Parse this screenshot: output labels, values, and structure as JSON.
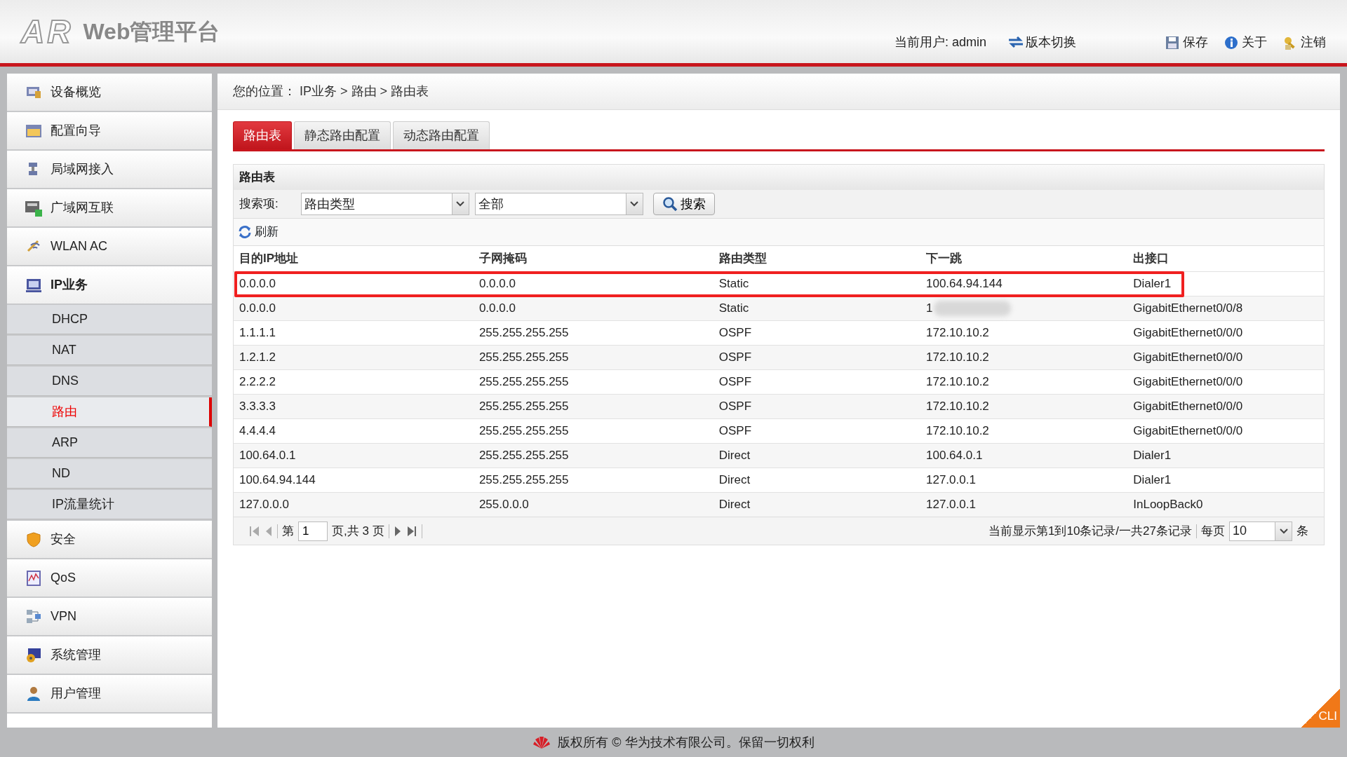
{
  "header": {
    "logo_text": "AR",
    "title": "Web管理平台",
    "user_label": "当前用户: admin",
    "actions": [
      {
        "label": "版本切换"
      },
      {
        "label": "保存"
      },
      {
        "label": "关于"
      },
      {
        "label": "注销"
      }
    ]
  },
  "sidebar": {
    "items": [
      {
        "label": "设备概览",
        "expanded": false
      },
      {
        "label": "配置向导",
        "expanded": false
      },
      {
        "label": "局域网接入",
        "expanded": false
      },
      {
        "label": "广域网互联",
        "expanded": false
      },
      {
        "label": "WLAN AC",
        "expanded": false
      },
      {
        "label": "IP业务",
        "expanded": true,
        "children": [
          {
            "label": "DHCP",
            "selected": false
          },
          {
            "label": "NAT",
            "selected": false
          },
          {
            "label": "DNS",
            "selected": false
          },
          {
            "label": "路由",
            "selected": true
          },
          {
            "label": "ARP",
            "selected": false
          },
          {
            "label": "ND",
            "selected": false
          },
          {
            "label": "IP流量统计",
            "selected": false
          }
        ]
      },
      {
        "label": "安全",
        "expanded": false
      },
      {
        "label": "QoS",
        "expanded": false
      },
      {
        "label": "VPN",
        "expanded": false
      },
      {
        "label": "系统管理",
        "expanded": false
      },
      {
        "label": "用户管理",
        "expanded": false
      }
    ]
  },
  "breadcrumb": "您的位置： IP业务 > 路由 > 路由表",
  "tabs": [
    {
      "label": "路由表",
      "selected": true
    },
    {
      "label": "静态路由配置",
      "selected": false
    },
    {
      "label": "动态路由配置",
      "selected": false
    }
  ],
  "panel": {
    "title": "路由表",
    "search_label": "搜索项:",
    "selects": [
      {
        "value": "路由类型"
      },
      {
        "value": "全部"
      }
    ],
    "search_button": "搜索",
    "refresh": "刷新"
  },
  "table": {
    "columns": [
      "目的IP地址",
      "子网掩码",
      "路由类型",
      "下一跳",
      "出接口"
    ],
    "rows": [
      {
        "cells": [
          "0.0.0.0",
          "0.0.0.0",
          "Static",
          "100.64.94.144",
          "Dialer1"
        ],
        "highlighted": true,
        "blurred": false
      },
      {
        "cells": [
          "0.0.0.0",
          "0.0.0.0",
          "Static",
          "1",
          "GigabitEthernet0/0/8"
        ],
        "highlighted": false,
        "blurred": true
      },
      {
        "cells": [
          "1.1.1.1",
          "255.255.255.255",
          "OSPF",
          "172.10.10.2",
          "GigabitEthernet0/0/0"
        ],
        "highlighted": false,
        "blurred": false
      },
      {
        "cells": [
          "1.2.1.2",
          "255.255.255.255",
          "OSPF",
          "172.10.10.2",
          "GigabitEthernet0/0/0"
        ],
        "highlighted": false,
        "blurred": false
      },
      {
        "cells": [
          "2.2.2.2",
          "255.255.255.255",
          "OSPF",
          "172.10.10.2",
          "GigabitEthernet0/0/0"
        ],
        "highlighted": false,
        "blurred": false
      },
      {
        "cells": [
          "3.3.3.3",
          "255.255.255.255",
          "OSPF",
          "172.10.10.2",
          "GigabitEthernet0/0/0"
        ],
        "highlighted": false,
        "blurred": false
      },
      {
        "cells": [
          "4.4.4.4",
          "255.255.255.255",
          "OSPF",
          "172.10.10.2",
          "GigabitEthernet0/0/0"
        ],
        "highlighted": false,
        "blurred": false
      },
      {
        "cells": [
          "100.64.0.1",
          "255.255.255.255",
          "Direct",
          "100.64.0.1",
          "Dialer1"
        ],
        "highlighted": false,
        "blurred": false
      },
      {
        "cells": [
          "100.64.94.144",
          "255.255.255.255",
          "Direct",
          "127.0.0.1",
          "Dialer1"
        ],
        "highlighted": false,
        "blurred": false
      },
      {
        "cells": [
          "127.0.0.0",
          "255.0.0.0",
          "Direct",
          "127.0.0.1",
          "InLoopBack0"
        ],
        "highlighted": false,
        "blurred": false
      }
    ]
  },
  "pagination": {
    "page_prefix": "第",
    "page": "1",
    "page_suffix": "页,共 3 页",
    "info": "当前显示第1到10条记录/一共27条记录",
    "per_page_label": "每页",
    "per_page": "10",
    "per_page_unit": "条"
  },
  "corner_badge": "CLI",
  "footer": "版权所有 © 华为技术有限公司。保留一切权利"
}
